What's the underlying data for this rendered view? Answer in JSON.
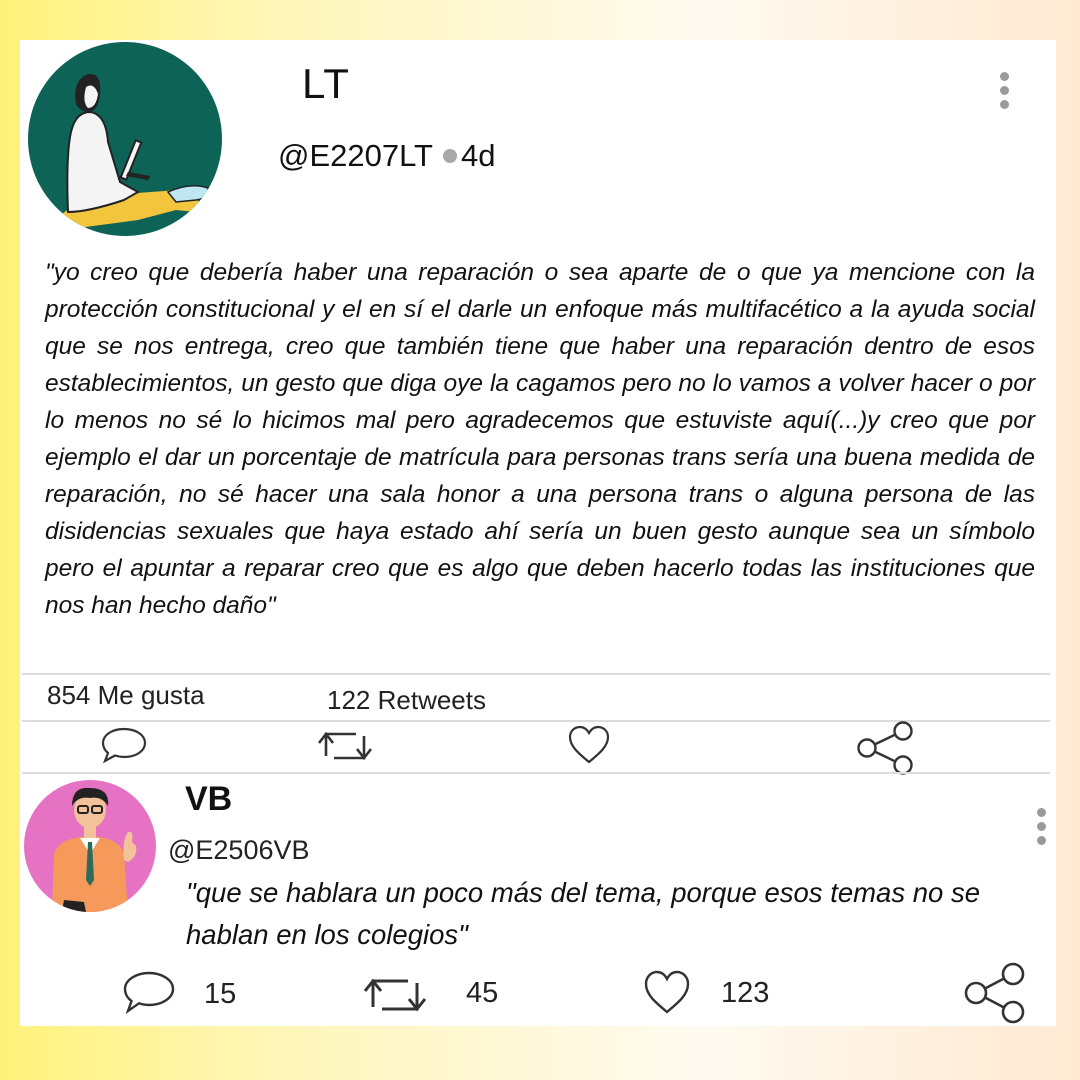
{
  "post": {
    "author": "LT",
    "handle": "@E2207LT",
    "time": "4d",
    "quote": "\"yo creo que debería haber una reparación o sea aparte de o que ya mencione con la protección constitucional y el en sí el darle un enfoque más multifacético a la ayuda social que se nos entrega, creo que también tiene que haber una reparación dentro de esos establecimientos, un gesto que diga oye la cagamos pero no lo vamos a volver hacer o por lo menos no sé lo hicimos mal pero agradecemos que estuviste aquí(...)y creo que por ejemplo el dar un porcentaje de matrícula para personas trans sería una buena medida de reparación, no sé hacer una sala honor a una persona trans o alguna persona de las disidencias sexuales que haya estado ahí sería un buen gesto aunque sea un símbolo pero el apuntar a reparar creo que es algo que deben hacerlo todas las instituciones que nos han hecho daño\"",
    "likes_text": "854 Me gusta",
    "retweets_text": "122 Retweets",
    "avatar_bg": "#0c6356",
    "actions": [
      "comment-icon",
      "retweet-icon",
      "heart-icon",
      "share-icon"
    ]
  },
  "reply": {
    "author": "VB",
    "handle": "@E2506VB",
    "quote": "\"que se hablara un poco más del tema, porque esos temas no se hablan en los colegios\"",
    "comments": "15",
    "retweets": "45",
    "likes": "123",
    "avatar_bg": "#e672c4",
    "actions": [
      "comment-icon",
      "retweet-icon",
      "heart-icon",
      "share-icon"
    ]
  }
}
